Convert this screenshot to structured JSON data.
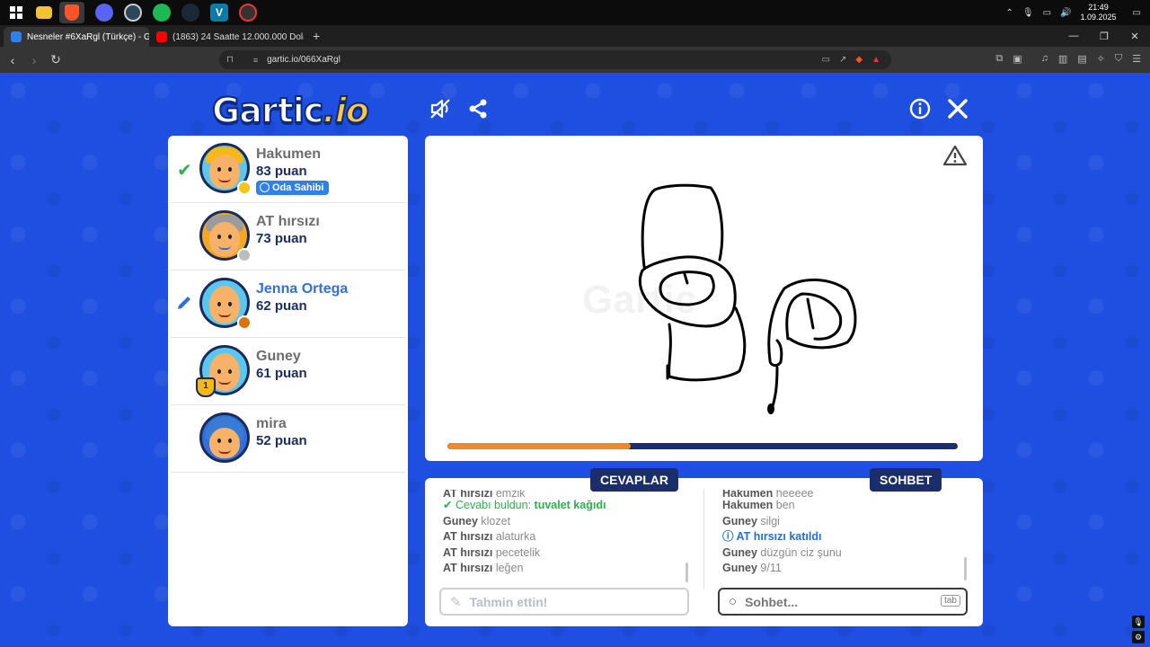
{
  "taskbar": {
    "icons": [
      "windows-icon",
      "explorer-icon",
      "brave-icon",
      "discord-icon",
      "steam-alt-icon",
      "spotify-icon",
      "steam-icon",
      "vscode-icon",
      "record-icon"
    ],
    "time": "21:49",
    "date": "1.09.2025"
  },
  "browser": {
    "tabs": [
      {
        "title": "Nesneler #6XaRgl (Türkçe) - Gar",
        "active": true
      },
      {
        "title": "(1863) 24 Saatte 12.000.000 Dolar To",
        "active": false
      }
    ],
    "url": "gartic.io/066XaRgl"
  },
  "game": {
    "logo_main": "Gartic",
    "logo_suffix": ".io",
    "players": [
      {
        "name": "Hakumen",
        "score": "83 puan",
        "badge": "Oda Sahibi",
        "marker": "check",
        "dot": "#f5c518",
        "hair": "#2b6fe0",
        "name_color": "#6d6d6d"
      },
      {
        "name": "AT hırsızı",
        "score": "73 puan",
        "badge": "",
        "marker": "",
        "dot": "#bdbdbd",
        "hair": "#6b6b6b",
        "name_color": "#6d6d6d"
      },
      {
        "name": "Jenna Ortega",
        "score": "62 puan",
        "badge": "",
        "marker": "pencil",
        "dot": "#d9730d",
        "hair": "#f7b26a",
        "name_color": "#2f6fe0"
      },
      {
        "name": "Guney",
        "score": "61 puan",
        "badge": "",
        "marker": "trophy",
        "dot": "",
        "hair": "#f7b26a",
        "name_color": "#6d6d6d"
      },
      {
        "name": "mira",
        "score": "52 puan",
        "badge": "",
        "marker": "",
        "dot": "",
        "hair": "#3a7bd5",
        "name_color": "#6d6d6d"
      }
    ],
    "trophy_rank": "1",
    "progress": 0.36,
    "answers": {
      "tag": "CEVAPLAR",
      "messages": [
        {
          "user": "AT hırsızı",
          "text": "emzik",
          "type": "normal"
        },
        {
          "user": "",
          "text": "Cevabı buldun:",
          "answer": "tuvalet kağıdı",
          "type": "correct"
        },
        {
          "user": "Guney",
          "text": "klozet",
          "type": "normal"
        },
        {
          "user": "AT hırsızı",
          "text": "alaturka",
          "type": "normal"
        },
        {
          "user": "AT hırsızı",
          "text": "pecetelik",
          "type": "normal"
        },
        {
          "user": "AT hırsızı",
          "text": "leğen",
          "type": "normal"
        }
      ],
      "placeholder": "Tahmin ettin!"
    },
    "chat": {
      "tag": "SOHBET",
      "messages": [
        {
          "user": "Hakumen",
          "text": "heeeee",
          "type": "normal"
        },
        {
          "user": "Hakumen",
          "text": "ben",
          "type": "normal"
        },
        {
          "user": "Guney",
          "text": "silgi",
          "type": "normal"
        },
        {
          "user": "AT hırsızı",
          "text": "katıldı",
          "type": "join"
        },
        {
          "user": "Guney",
          "text": "düzgün ciz şunu",
          "type": "normal"
        },
        {
          "user": "Guney",
          "text": "9/11",
          "type": "normal"
        }
      ],
      "placeholder": "Sohbet...",
      "key_hint": "tab"
    }
  }
}
